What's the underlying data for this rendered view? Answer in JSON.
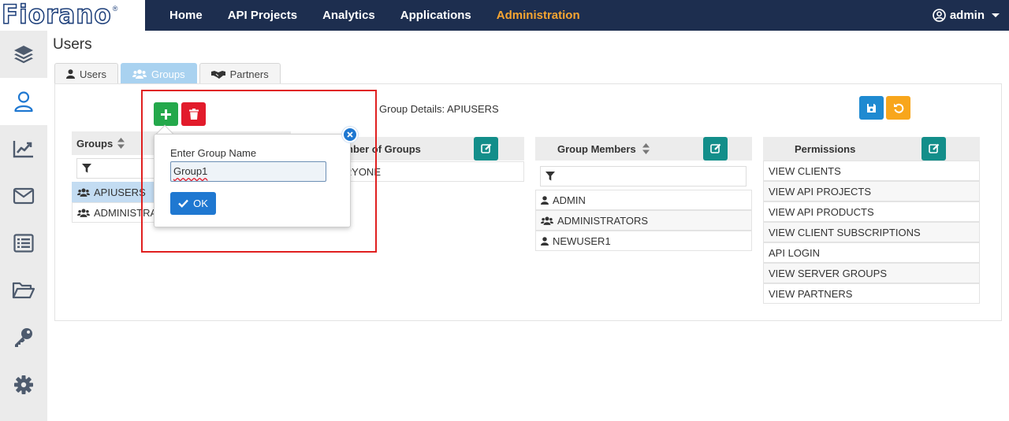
{
  "app": {
    "logo_text": "Fiorano",
    "logo_mark": "®"
  },
  "nav": {
    "items": [
      {
        "label": "Home",
        "active": false
      },
      {
        "label": "API Projects",
        "active": false
      },
      {
        "label": "Analytics",
        "active": false
      },
      {
        "label": "Applications",
        "active": false
      },
      {
        "label": "Administration",
        "active": true
      }
    ],
    "user": "admin"
  },
  "sidebar": {
    "items": [
      {
        "icon": "layers-icon",
        "active": false
      },
      {
        "icon": "user-icon",
        "active": true
      },
      {
        "icon": "chart-line-icon",
        "active": false
      },
      {
        "icon": "envelope-icon",
        "active": false
      },
      {
        "icon": "list-icon",
        "active": false
      },
      {
        "icon": "folder-open-icon",
        "active": false
      },
      {
        "icon": "key-icon",
        "active": false
      },
      {
        "icon": "gear-icon",
        "active": false
      }
    ]
  },
  "page": {
    "title": "Users",
    "tabs": [
      {
        "label": "Users",
        "icon": "user-icon",
        "active": false
      },
      {
        "label": "Groups",
        "icon": "users-icon",
        "active": true
      },
      {
        "label": "Partners",
        "icon": "handshake-icon",
        "active": false
      }
    ]
  },
  "groups": {
    "header": "Groups",
    "rows": [
      "APIUSERS",
      "ADMINISTRA"
    ]
  },
  "details": {
    "title": "Group Details: APIUSERS"
  },
  "member_of": {
    "header": "nber of Groups",
    "rows": [
      "RYONE"
    ]
  },
  "members": {
    "header": "Group Members",
    "rows": [
      {
        "label": "ADMIN",
        "icon": "user-icon"
      },
      {
        "label": "ADMINISTRATORS",
        "icon": "users-icon"
      },
      {
        "label": "NEWUSER1",
        "icon": "user-icon"
      }
    ]
  },
  "permissions": {
    "header": "Permissions",
    "rows": [
      "VIEW CLIENTS",
      "VIEW API PROJECTS",
      "VIEW API PRODUCTS",
      "VIEW CLIENT SUBSCRIPTIONS",
      "API LOGIN",
      "VIEW SERVER GROUPS",
      "VIEW PARTNERS"
    ]
  },
  "popover": {
    "label": "Enter Group Name",
    "value": "Group1",
    "ok_label": "OK"
  },
  "colors": {
    "topbar": "#1d2e4f",
    "active_nav": "#f7a531",
    "teal": "#138e8a",
    "green": "#24a84b",
    "red": "#e21b2b",
    "blue": "#1f78d1",
    "orange": "#f8a61c"
  }
}
